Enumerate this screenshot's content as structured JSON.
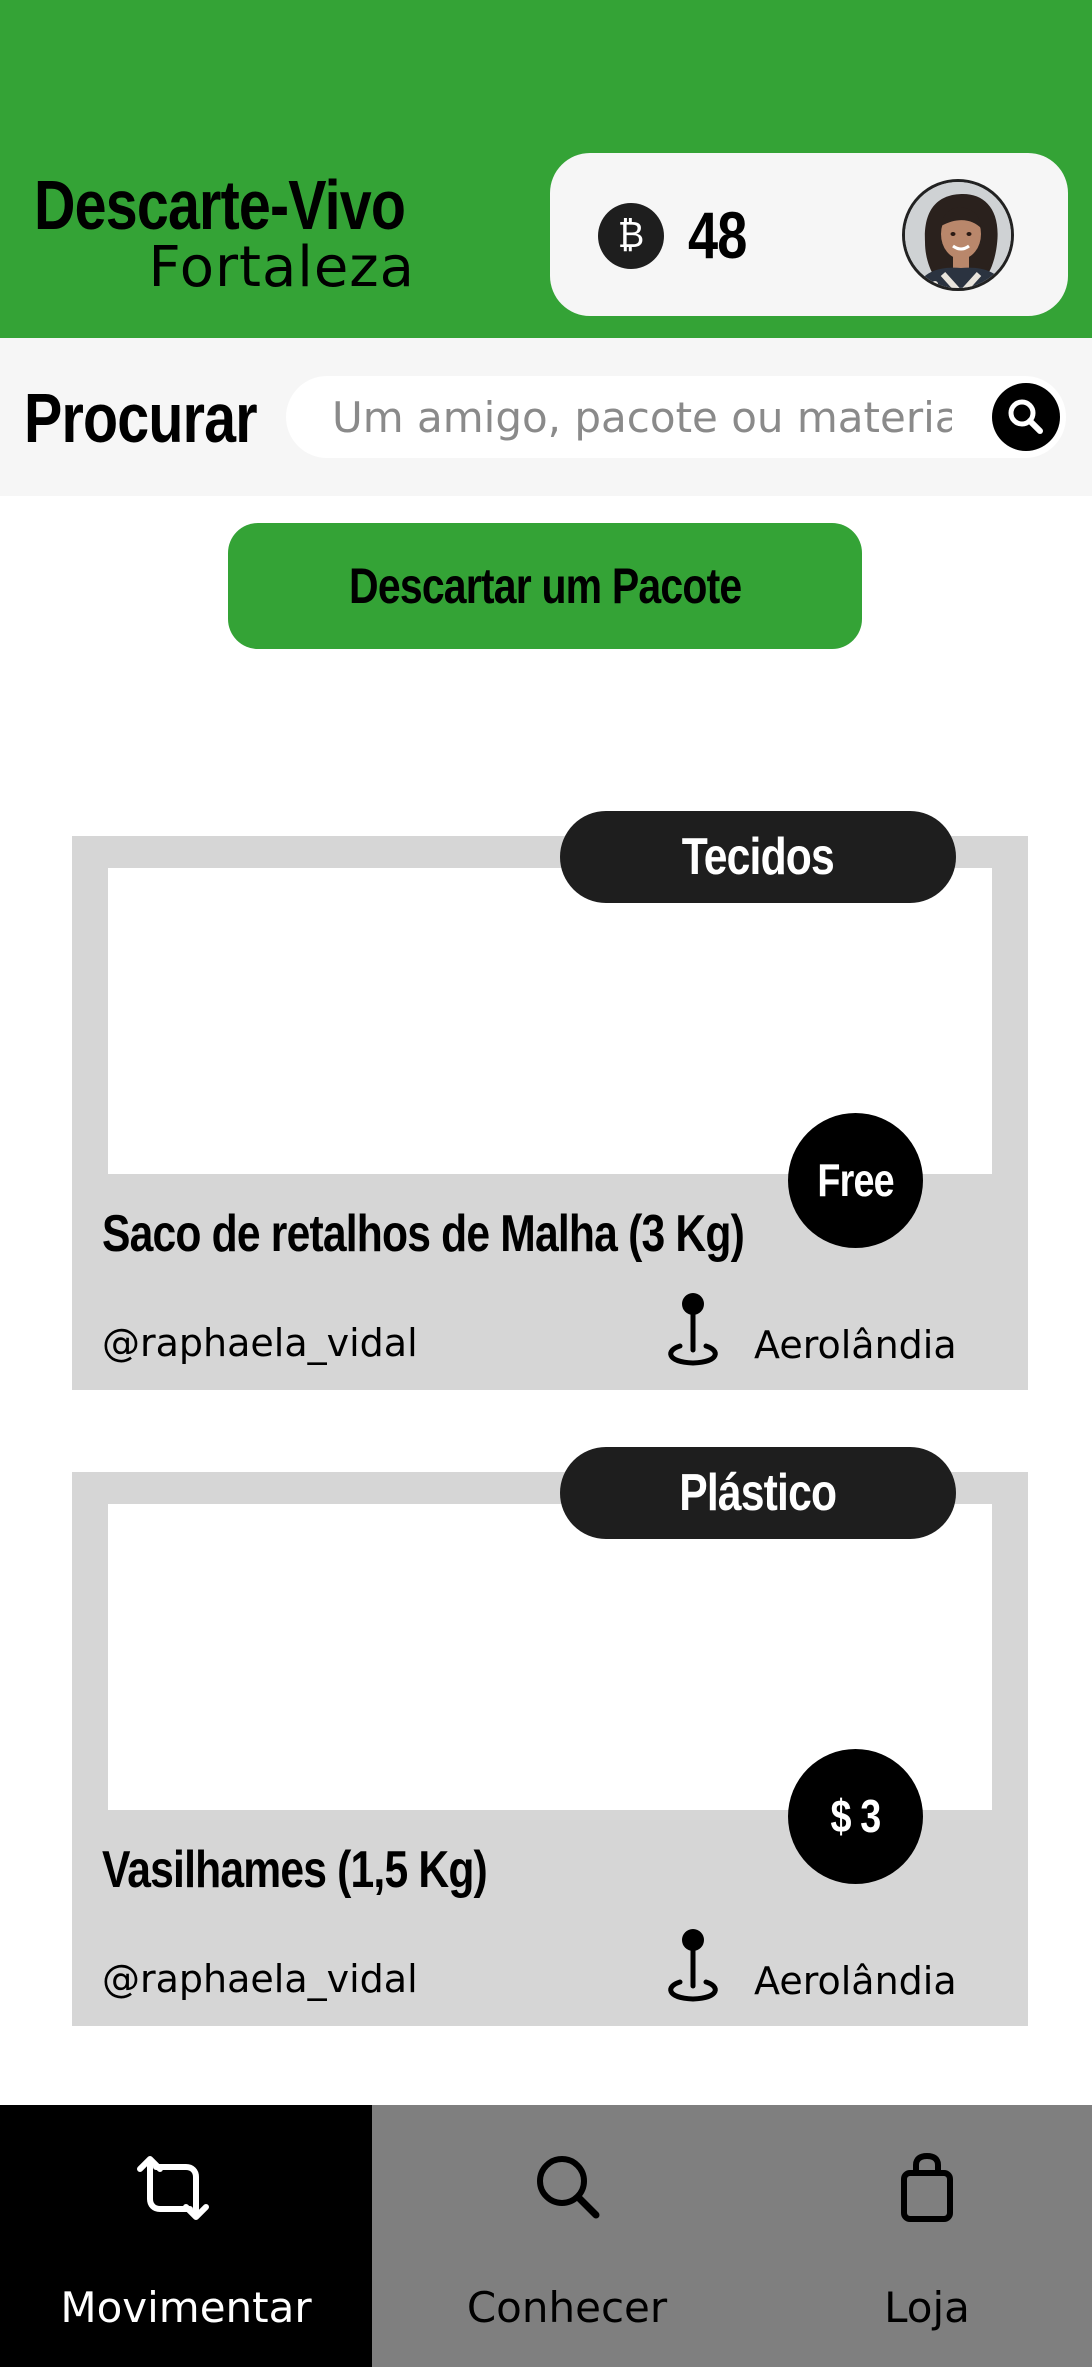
{
  "header": {
    "brand_title": "Descarte-Vivo",
    "brand_subtitle": "Fortaleza",
    "coin_icon": "bitcoin-icon",
    "coin_symbol": "₿",
    "coin_count": "48",
    "accent_color": "#34a336"
  },
  "search": {
    "label": "Procurar",
    "placeholder": "Um amigo, pacote ou material",
    "icon": "search-icon"
  },
  "discard_button": {
    "label": "Descartar um Pacote"
  },
  "cards": [
    {
      "category": "Tecidos",
      "price": "Free",
      "title": "Saco de retalhos de Malha (3 Kg)",
      "user": "@raphaela_vidal",
      "location": "Aerolândia"
    },
    {
      "category": "Plástico",
      "price": "$ 3",
      "title": "Vasilhames  (1,5 Kg)",
      "user": "@raphaela_vidal",
      "location": "Aerolândia"
    }
  ],
  "nav": {
    "items": [
      {
        "label": "Movimentar",
        "icon": "repost-icon",
        "active": true
      },
      {
        "label": "Conhecer",
        "icon": "search-icon",
        "active": false
      },
      {
        "label": "Loja",
        "icon": "shopping-bag-icon",
        "active": false
      }
    ]
  }
}
